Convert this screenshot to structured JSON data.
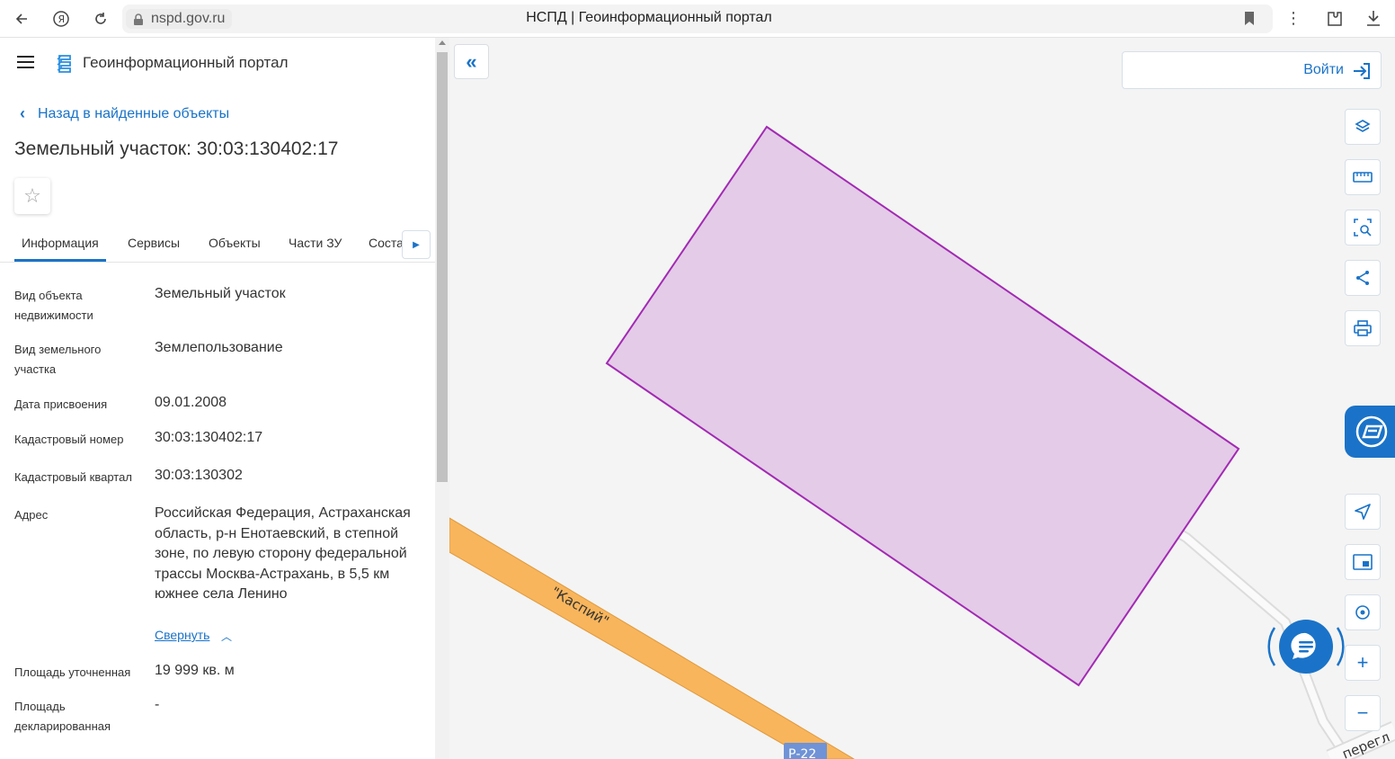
{
  "browser": {
    "url": "nspd.gov.ru",
    "tab_title": "НСПД | Геоинформационный портал"
  },
  "header": {
    "portal_name": "Геоинформационный портал"
  },
  "panel": {
    "back_label": "Назад в найденные объекты",
    "title": "Земельный участок: 30:03:130402:17",
    "tabs": [
      {
        "label": "Информация"
      },
      {
        "label": "Сервисы"
      },
      {
        "label": "Объекты"
      },
      {
        "label": "Части ЗУ"
      },
      {
        "label": "Состав ЗУ"
      }
    ],
    "properties": [
      {
        "label": "Вид объекта недвижимости",
        "value": "Земельный участок"
      },
      {
        "label": "Вид земельного участка",
        "value": "Землепользование"
      },
      {
        "label": "Дата присвоения",
        "value": "09.01.2008"
      },
      {
        "label": "Кадастровый номер",
        "value": "30:03:130402:17"
      },
      {
        "label": "Кадастровый квартал",
        "value": "30:03:130302"
      },
      {
        "label": "Адрес",
        "value": "Российская Федерация, Астраханская область, р-н Енотаевский, в степной зоне, по левую сторону федеральной трассы Москва-Астрахань, в 5,5 км южнее села Ленино"
      },
      {
        "label": "Площадь уточненная",
        "value": "19 999 кв. м"
      },
      {
        "label": "Площадь декларированная",
        "value": "-"
      }
    ],
    "collapse_label": "Свернуть"
  },
  "map": {
    "login_label": "Войти",
    "road_label": "\"Каспий\"",
    "road_shield": "Р-22",
    "street_label": "перегл",
    "parcel_color": "#e4cbe8",
    "parcel_border": "#a22ab3",
    "road_color": "#f8b55c",
    "accent": "#1a73c8"
  }
}
